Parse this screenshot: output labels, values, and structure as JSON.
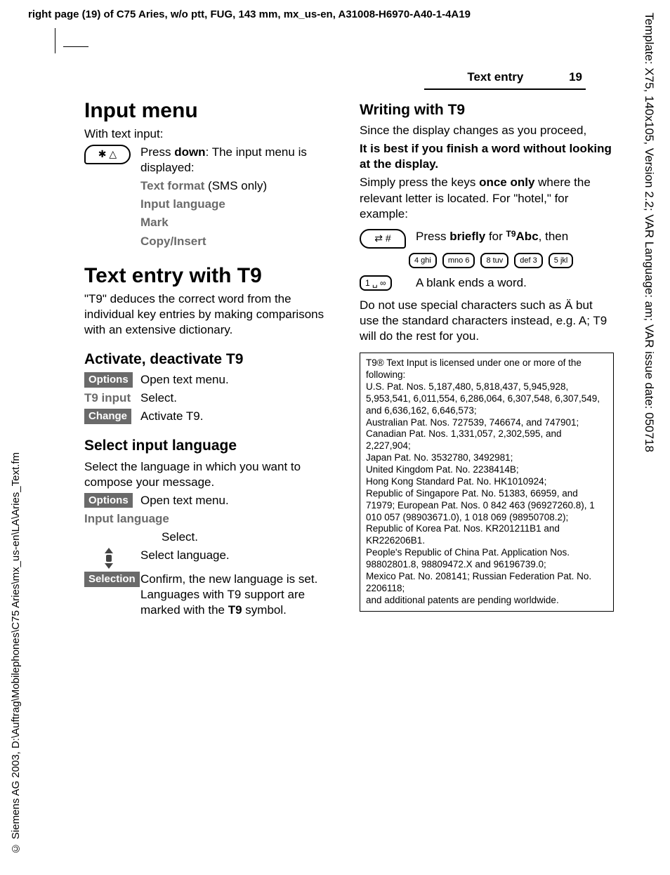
{
  "meta": {
    "header_prefix": "right page (19)",
    "header_rest": " of C75 Aries, w/o ptt, FUG, 143 mm, mx_us-en, A31008-H6970-A40-1-4A19",
    "side_template": "Template: X75, 140x105, Version 2.2; VAR Language: am; VAR issue date: 050718",
    "side_sourcefile": "© Siemens AG 2003, D:\\Auftrag\\Mobilephones\\C75 Aries\\mx_us-en\\LA\\Aries_Text.fm"
  },
  "running_head": {
    "section": "Text entry",
    "page": "19"
  },
  "left": {
    "h1": "Input menu",
    "intro": "With text input:",
    "star_key": "✱ △",
    "press_down_a": "Press ",
    "press_down_bold": "down",
    "press_down_b": ": The input menu is displayed:",
    "menu_items": {
      "text_format_label": "Text format",
      "text_format_suffix": " (SMS only)",
      "input_language": "Input language",
      "mark": "Mark",
      "copy_insert": "Copy/Insert"
    },
    "h1b": "Text entry with T9",
    "t9_desc": "\"T9\" deduces the correct word from the individual key entries by making comparisons with an extensive dictionary.",
    "h2_activate": "Activate, deactivate T9",
    "options_label": "Options",
    "options_desc": "Open text menu.",
    "t9_input_label": "T9 input",
    "t9_input_desc": "Select.",
    "change_label": "Change",
    "change_desc": "Activate T9.",
    "h2_lang": "Select input language",
    "lang_desc": "Select the language in which you want to compose your message.",
    "options2_desc": "Open text menu.",
    "input_lang_label": "Input language",
    "input_lang_desc": "Select.",
    "select_lang_desc": "Select language.",
    "selection_label": "Selection",
    "selection_desc_a": "Confirm, the new language is set. Languages with T9 support are marked with the ",
    "selection_desc_bold": "T9",
    "selection_desc_b": " symbol."
  },
  "right": {
    "h2_writing": "Writing with T9",
    "proceed": "Since the display changes as you proceed,",
    "best": "It is best if you finish a word without looking at the display.",
    "simply_a": "Simply press the keys ",
    "simply_bold": "once only",
    "simply_b": " where the relevant letter is located. For \"hotel,\" for example:",
    "hash_key": "⇄ #",
    "press_brief_a": "Press ",
    "press_brief_bold": "briefly",
    "press_brief_b": " for ",
    "press_brief_t9": "T9",
    "press_brief_abc": "Abc",
    "press_brief_c": ", then",
    "keys": [
      "4 ghi",
      "mno 6",
      "8 tuv",
      "def 3",
      "5 jkl"
    ],
    "space_key": "1 ␣ ∞",
    "blank_desc": "A blank ends a word.",
    "special_chars": "Do not use special characters such as Ä but use the standard characters instead, e.g. A; T9 will do the rest for you.",
    "legal": "T9® Text Input is licensed under one or more of the following:\nU.S. Pat. Nos. 5,187,480, 5,818,437, 5,945,928, 5,953,541, 6,011,554, 6,286,064, 6,307,548, 6,307,549, and 6,636,162, 6,646,573;\nAustralian Pat. Nos.  727539, 746674, and 747901; Canadian Pat. Nos. 1,331,057, 2,302,595, and 2,227,904;\nJapan Pat. No. 3532780, 3492981;\nUnited Kingdom Pat. No. 2238414B;\nHong Kong Standard Pat. No. HK1010924;\nRepublic of Singapore Pat. No. 51383, 66959, and 71979; European Pat. Nos. 0 842 463 (96927260.8), 1 010 057 (98903671.0), 1 018 069 (98950708.2); Republic of Korea Pat. Nos. KR201211B1 and KR226206B1.\nPeople's Republic of China Pat. Application Nos. 98802801.8, 98809472.X and 96196739.0;\nMexico Pat. No. 208141; Russian Federation Pat. No. 2206118;\nand additional patents are pending worldwide."
  }
}
